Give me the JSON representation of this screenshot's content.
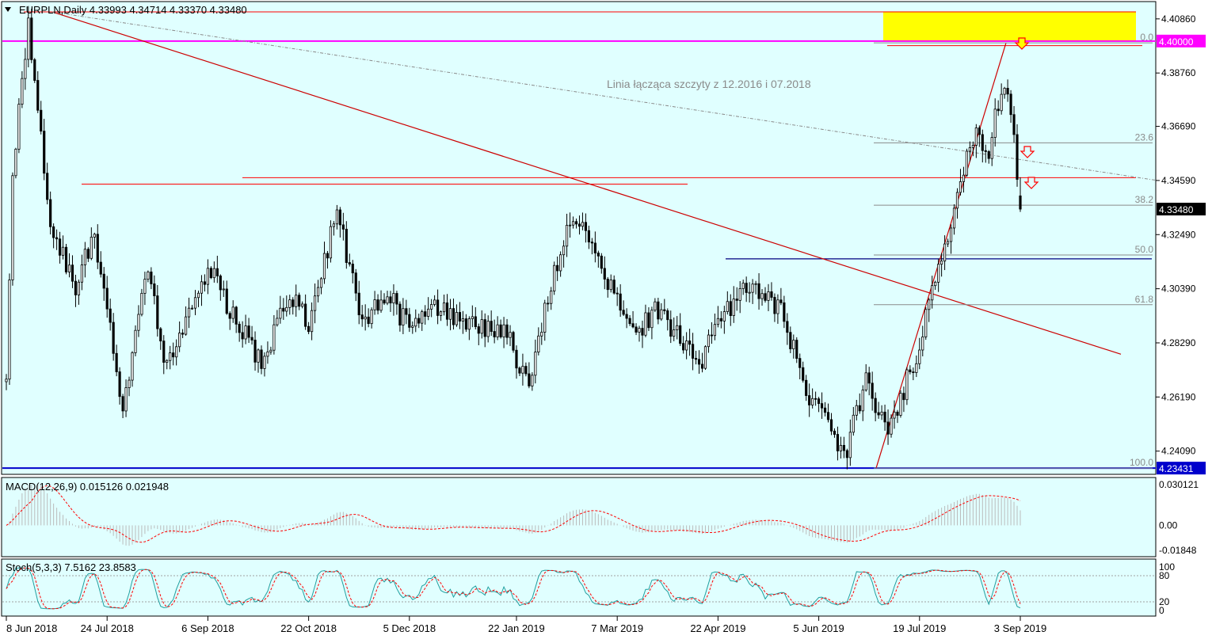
{
  "main_panel": {
    "header": "EURPLN,Daily  4.33993 4.34714 4.33370 4.33480",
    "annotation": "Linia łącząca szczyty z 12.2016 i 07.2018",
    "price_labels": [
      "4.40860",
      "4.38760",
      "4.36690",
      "4.34590",
      "4.32490",
      "4.30390",
      "4.28290",
      "4.26190",
      "4.24090"
    ],
    "highlight_labels": [
      {
        "text": "4.40000",
        "value": 4.4,
        "bg": "#ff00ff"
      },
      {
        "text": "4.33480",
        "value": 4.3348,
        "bg": "#000000"
      },
      {
        "text": "4.23431",
        "value": 4.23431,
        "bg": "#0000cc"
      }
    ],
    "fib_levels": [
      {
        "label": "0.0",
        "value": 4.3993
      },
      {
        "label": "23.6",
        "value": 4.3605
      },
      {
        "label": "38.2",
        "value": 4.3363
      },
      {
        "label": "50.0",
        "value": 4.317
      },
      {
        "label": "61.8",
        "value": 4.2977
      },
      {
        "label": "100.0",
        "value": 4.2343
      }
    ]
  },
  "macd_panel": {
    "header": "MACD(12,26,9) 0.015126 0.021948",
    "labels": [
      "0.030121",
      "0.00",
      "-0.01848"
    ]
  },
  "stoch_panel": {
    "header": "Stoch(5,3,3) 7.5162 23.8583",
    "labels": [
      "100",
      "80",
      "20",
      "0"
    ]
  },
  "x_labels": [
    "8 Jun 2018",
    "24 Jul 2018",
    "6 Sep 2018",
    "22 Oct 2018",
    "5 Dec 2018",
    "22 Jan 2019",
    "7 Mar 2019",
    "22 Apr 2019",
    "5 Jun 2019",
    "19 Jul 2019",
    "3 Sep 2019"
  ],
  "colors": {
    "background": "#e0ffff",
    "candle": "#000000",
    "resistance": "#ff0000",
    "trend": "#cc0000",
    "magenta": "#ff00ff",
    "support": "#0000cc",
    "zone": "#ffff00",
    "macd_hist": "#bbbbbb",
    "macd_signal": "#ff0000",
    "stoch_main": "#20a0a0",
    "stoch_signal": "#ff0000"
  },
  "chart_data": {
    "type": "candlestick",
    "symbol": "EURPLN",
    "timeframe": "Daily",
    "ylim": [
      4.2322,
      4.415
    ],
    "last": {
      "open": 4.33993,
      "high": 4.34714,
      "low": 4.3337,
      "close": 4.3348
    },
    "anchors": [
      {
        "date": "8 Jun 2018",
        "price": 4.266
      },
      {
        "date": "12 Jun 2018",
        "price": 4.35
      },
      {
        "date": "19 Jun 2018",
        "price": 4.405
      },
      {
        "date": "28 Jun 2018",
        "price": 4.33
      },
      {
        "date": "10 Jul 2018",
        "price": 4.305
      },
      {
        "date": "18 Jul 2018",
        "price": 4.325
      },
      {
        "date": "31 Jul 2018",
        "price": 4.256
      },
      {
        "date": "10 Aug 2018",
        "price": 4.312
      },
      {
        "date": "20 Aug 2018",
        "price": 4.272
      },
      {
        "date": "6 Sep 2018",
        "price": 4.312
      },
      {
        "date": "18 Sep 2018",
        "price": 4.294
      },
      {
        "date": "1 Oct 2018",
        "price": 4.275
      },
      {
        "date": "12 Oct 2018",
        "price": 4.302
      },
      {
        "date": "22 Oct 2018",
        "price": 4.29
      },
      {
        "date": "2 Nov 2018",
        "price": 4.335
      },
      {
        "date": "14 Nov 2018",
        "price": 4.29
      },
      {
        "date": "26 Nov 2018",
        "price": 4.302
      },
      {
        "date": "5 Dec 2018",
        "price": 4.288
      },
      {
        "date": "17 Dec 2018",
        "price": 4.296
      },
      {
        "date": "3 Jan 2019",
        "price": 4.289
      },
      {
        "date": "17 Jan 2019",
        "price": 4.286
      },
      {
        "date": "28 Jan 2019",
        "price": 4.265
      },
      {
        "date": "5 Feb 2019",
        "price": 4.3
      },
      {
        "date": "14 Feb 2019",
        "price": 4.332
      },
      {
        "date": "22 Feb 2019",
        "price": 4.323
      },
      {
        "date": "7 Mar 2019",
        "price": 4.298
      },
      {
        "date": "18 Mar 2019",
        "price": 4.288
      },
      {
        "date": "26 Mar 2019",
        "price": 4.296
      },
      {
        "date": "5 Apr 2019",
        "price": 4.282
      },
      {
        "date": "12 Apr 2019",
        "price": 4.274
      },
      {
        "date": "22 Apr 2019",
        "price": 4.29
      },
      {
        "date": "6 May 2019",
        "price": 4.306
      },
      {
        "date": "20 May 2019",
        "price": 4.295
      },
      {
        "date": "31 May 2019",
        "price": 4.262
      },
      {
        "date": "5 Jun 2019",
        "price": 4.258
      },
      {
        "date": "17 Jun 2019",
        "price": 4.238
      },
      {
        "date": "26 Jun 2019",
        "price": 4.268
      },
      {
        "date": "5 Jul 2019",
        "price": 4.248
      },
      {
        "date": "12 Jul 2019",
        "price": 4.265
      },
      {
        "date": "19 Jul 2019",
        "price": 4.282
      },
      {
        "date": "26 Jul 2019",
        "price": 4.308
      },
      {
        "date": "2 Aug 2019",
        "price": 4.325
      },
      {
        "date": "9 Aug 2019",
        "price": 4.356
      },
      {
        "date": "14 Aug 2019",
        "price": 4.363
      },
      {
        "date": "20 Aug 2019",
        "price": 4.358
      },
      {
        "date": "26 Aug 2019",
        "price": 4.382
      },
      {
        "date": "29 Aug 2019",
        "price": 4.372
      },
      {
        "date": "3 Sep 2019",
        "price": 4.3348
      }
    ]
  }
}
